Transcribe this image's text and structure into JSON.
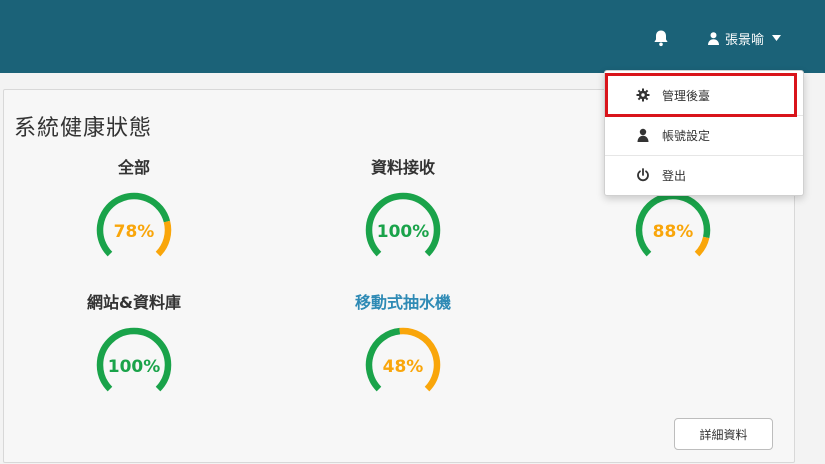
{
  "header": {
    "user_name": "張景喻",
    "icons": {
      "notifications": "bell-icon",
      "user": "user-icon",
      "menu": "caret-down-icon"
    }
  },
  "user_menu": {
    "items": [
      {
        "label": "管理後臺",
        "icon": "gear-icon",
        "highlighted": true
      },
      {
        "label": "帳號設定",
        "icon": "user-icon"
      },
      {
        "label": "登出",
        "icon": "power-icon"
      }
    ]
  },
  "panel": {
    "title": "系統健康狀態",
    "gauges": [
      {
        "label": "全部",
        "percent": 78,
        "display": "78%",
        "color": "#f9a60b",
        "link": false
      },
      {
        "label": "資料接收",
        "percent": 100,
        "display": "100%",
        "color": "#1aa34a",
        "link": false
      },
      {
        "label": "",
        "percent": 88,
        "display": "88%",
        "color": "#f9a60b",
        "link": false
      },
      {
        "label": "網站&資料庫",
        "percent": 100,
        "display": "100%",
        "color": "#1aa34a",
        "link": false
      },
      {
        "label": "移動式抽水機",
        "percent": 48,
        "display": "48%",
        "color": "#f9a60b",
        "link": true
      }
    ],
    "detail_button": "詳細資料"
  },
  "colors": {
    "header_bg": "#1b6278",
    "good": "#1aa34a",
    "warning": "#f9a60b",
    "highlight": "#d9141b",
    "link": "#2e8ab5"
  }
}
